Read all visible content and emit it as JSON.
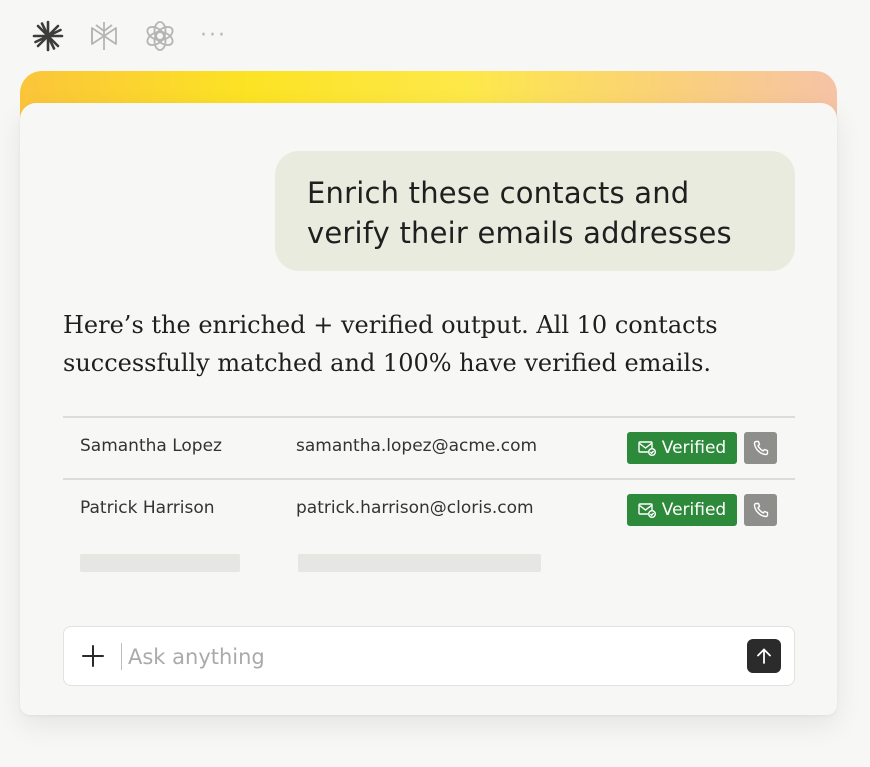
{
  "toolbar": {
    "icons": [
      "claude-logo-icon",
      "perplexity-logo-icon",
      "openai-logo-icon",
      "more-icon"
    ],
    "more_label": "···"
  },
  "conversation": {
    "user_message_line1": "Enrich these contacts and",
    "user_message_line2": "verify their emails addresses",
    "assistant_line1": "Here’s the enriched + verified output. All 10 contacts",
    "assistant_line2": "successfully matched and 100% have verified emails."
  },
  "contacts": {
    "rows": [
      {
        "name": "Samantha Lopez",
        "email": "samantha.lopez@acme.com",
        "status": "Verified"
      },
      {
        "name": "Patrick Harrison",
        "email": "patrick.harrison@cloris.com",
        "status": "Verified"
      }
    ]
  },
  "input": {
    "placeholder": "Ask anything",
    "value": ""
  },
  "colors": {
    "verified_badge": "#2e8a3b",
    "phone_button": "#8e8e8a",
    "user_bubble": "#e8ebde",
    "send_button": "#2b2b2b",
    "gradient_start": "#fbc53b",
    "gradient_end": "#f6c3a6"
  }
}
